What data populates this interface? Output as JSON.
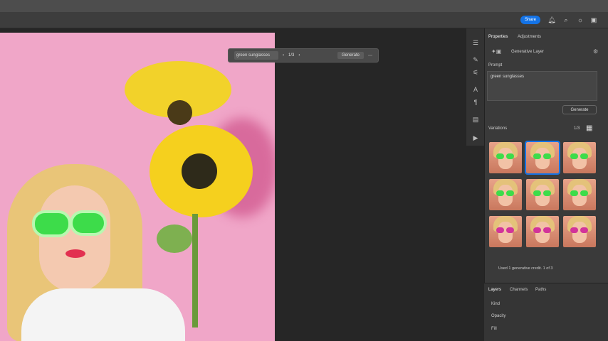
{
  "topbar": {
    "share_label": "Share"
  },
  "context_bar": {
    "prompt": "green sunglasses",
    "counter": "1/3",
    "generate_label": "Generate"
  },
  "properties": {
    "tabs": [
      "Properties",
      "Adjustments"
    ],
    "layer_type": "Generative Layer",
    "prompt_label": "Prompt",
    "prompt_value": "green sunglasses",
    "generate_label": "Generate",
    "variations_label": "Variations",
    "variations_count": "1/3",
    "footer_note": "Used 1 generative credit. 1 of 3"
  },
  "variations": [
    {
      "glasses": "#3ddc4a",
      "selected": false
    },
    {
      "glasses": "#3ddc4a",
      "selected": true
    },
    {
      "glasses": "#3ddc4a",
      "selected": false
    },
    {
      "glasses": "#3ddc4a",
      "selected": false
    },
    {
      "glasses": "#3ddc4a",
      "selected": false
    },
    {
      "glasses": "#3ddc4a",
      "selected": false
    },
    {
      "glasses": "#d2349a",
      "selected": false
    },
    {
      "glasses": "#d2349a",
      "selected": false
    },
    {
      "glasses": "#d2349a",
      "selected": false
    }
  ],
  "layers_panel": {
    "tabs": [
      "Layers",
      "Channels",
      "Paths"
    ],
    "kind_label": "Kind",
    "opacity_label": "Opacity",
    "fill_label": "Fill"
  },
  "colors": {
    "accent": "#1473e6",
    "canvas_bg": "#f0a6c8"
  }
}
